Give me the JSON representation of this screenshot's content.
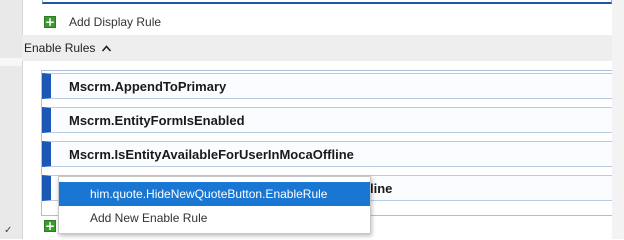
{
  "display_rules": {
    "add_label": "Add Display Rule"
  },
  "enable_rules": {
    "section_title": "Enable Rules",
    "collapse_icon": "chevron-up-icon",
    "rules": [
      {
        "label": "Mscrm.AppendToPrimary"
      },
      {
        "label": "Mscrm.EntityFormIsEnabled"
      },
      {
        "label": "Mscrm.IsEntityAvailableForUserInMocaOffline"
      },
      {
        "label": "line"
      }
    ]
  },
  "context_menu": {
    "items": [
      {
        "label": "him.quote.HideNewQuoteButton.EnableRule",
        "selected": true
      },
      {
        "label": "Add New Enable Rule",
        "selected": false
      }
    ]
  },
  "colors": {
    "accent": "#1b57b4",
    "selected_bg": "#1976d3",
    "plus_green": "#3a9b2c"
  }
}
